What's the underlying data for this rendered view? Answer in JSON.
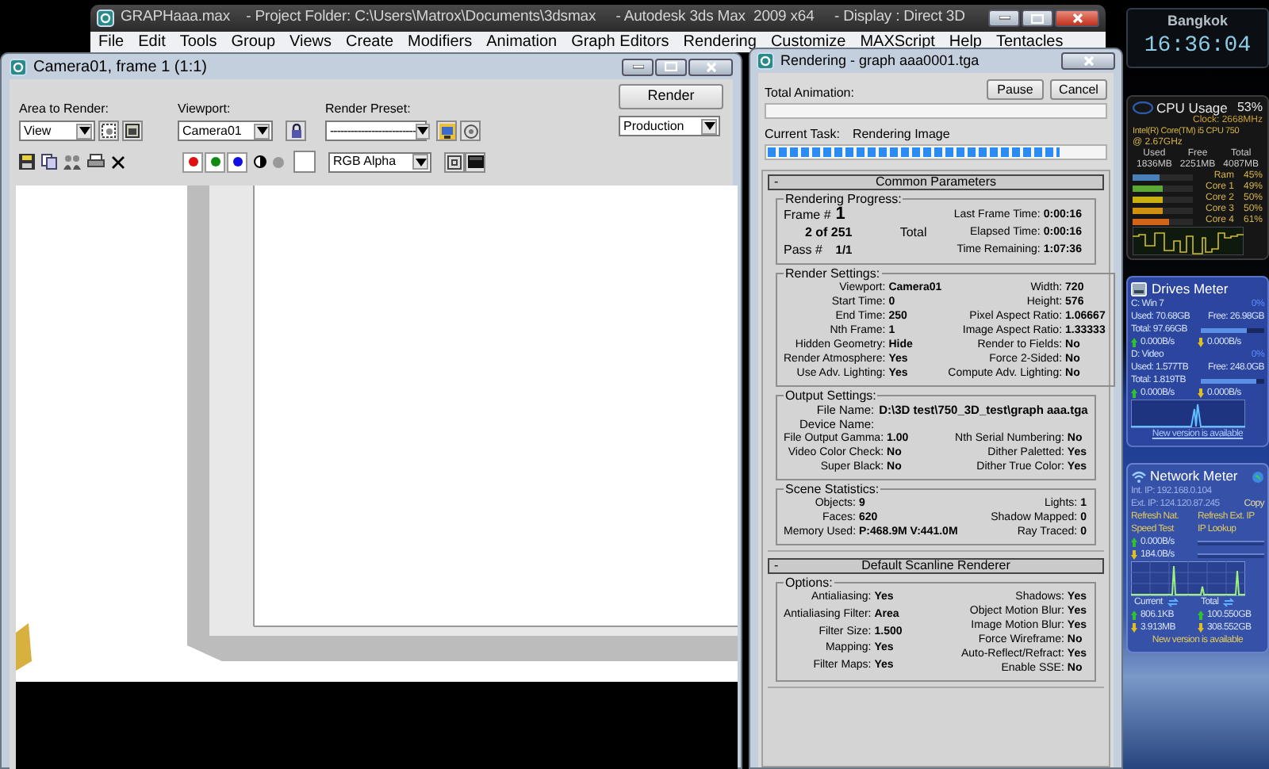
{
  "max_window": {
    "title": "GRAPHaaa.max    - Project Folder: C:\\Users\\Matrox\\Documents\\3dsmax     - Autodesk 3ds Max  2009 x64     - Display : Direct 3D",
    "menu": [
      "File",
      "Edit",
      "Tools",
      "Group",
      "Views",
      "Create",
      "Modifiers",
      "Animation",
      "Graph Editors",
      "Rendering",
      "Customize",
      "MAXScript",
      "Help",
      "Tentacles"
    ]
  },
  "frame_window": {
    "title": "Camera01, frame 1 (1:1)",
    "area_label": "Area to Render:",
    "area_value": "View",
    "viewport_label": "Viewport:",
    "viewport_value": "Camera01",
    "preset_label": "Render Preset:",
    "preset_value": "-------------------------",
    "render_button": "Render",
    "mode_value": "Production",
    "channels": [
      {
        "color": "#e01010"
      },
      {
        "color": "#108a10"
      },
      {
        "color": "#1010e0"
      }
    ],
    "display_value": "RGB Alpha"
  },
  "render_dialog": {
    "title": "Rendering - graph aaa0001.tga",
    "buttons": [
      "Pause",
      "Cancel"
    ],
    "total_animation": {
      "label": "Total Animation:",
      "level": 0
    },
    "current_task": {
      "label": "Current Task:",
      "value": "Rendering Image",
      "level": 0.87
    },
    "rollouts": [
      {
        "expander": "-",
        "title": "Common Parameters",
        "groups": [
          {
            "kind": "progress",
            "title": "Rendering Progress:",
            "frame_label": "Frame #",
            "frame_value": "1",
            "count": "2 of 251",
            "total": "Total",
            "pass_label": "Pass #",
            "pass_value": "1/1",
            "right": [
              {
                "label": "Last Frame Time:",
                "value": "0:00:16"
              },
              {
                "label": "Elapsed Time:",
                "value": "0:00:16"
              },
              {
                "label": "Time Remaining:",
                "value": "1:07:36"
              }
            ]
          },
          {
            "kind": "fields",
            "title": "Render Settings:",
            "left": [
              {
                "label": "Viewport:",
                "value": "Camera01"
              },
              {
                "label": "Start Time:",
                "value": "0"
              },
              {
                "label": "End Time:",
                "value": "250"
              },
              {
                "label": "Nth Frame:",
                "value": "1"
              },
              {
                "label": "Hidden Geometry:",
                "value": "Hide"
              },
              {
                "label": "Render Atmosphere:",
                "value": "Yes"
              },
              {
                "label": "Use Adv. Lighting:",
                "value": "Yes"
              }
            ],
            "right": [
              {
                "label": "Width:",
                "value": "720"
              },
              {
                "label": "Height:",
                "value": "576"
              },
              {
                "label": "Pixel Aspect Ratio:",
                "value": "1.06667"
              },
              {
                "label": "Image Aspect Ratio:",
                "value": "1.33333"
              },
              {
                "label": "Render to Fields:",
                "value": "No"
              },
              {
                "label": "Force 2-Sided:",
                "value": "No"
              },
              {
                "label": "Compute Adv. Lighting:",
                "value": "No"
              }
            ]
          },
          {
            "kind": "fields",
            "title": "Output Settings:",
            "full": [
              {
                "label": "File Name:",
                "value": "D:\\3D test\\750_3D_test\\graph aaa.tga"
              },
              {
                "label": "Device Name:"
              }
            ],
            "left": [
              {
                "label": "File Output Gamma:",
                "value": "1.00"
              },
              {
                "label": "Video Color Check:",
                "value": "No"
              },
              {
                "label": "Super Black:",
                "value": "No"
              }
            ],
            "right": [
              {
                "label": "Nth Serial Numbering:",
                "value": "No"
              },
              {
                "label": "Dither Paletted:",
                "value": "Yes"
              },
              {
                "label": "Dither True Color:",
                "value": "Yes"
              }
            ]
          },
          {
            "kind": "fields",
            "title": "Scene Statistics:",
            "left": [
              {
                "label": "Objects:",
                "value": "9"
              },
              {
                "label": "Faces:",
                "value": "620"
              },
              {
                "label": "Memory Used:",
                "value": "P:468.9M V:441.0M"
              }
            ],
            "right": [
              {
                "label": "Lights:",
                "value": "1"
              },
              {
                "label": "Shadow Mapped:",
                "value": "0"
              },
              {
                "label": "Ray Traced:",
                "value": "0"
              }
            ]
          }
        ]
      },
      {
        "expander": "-",
        "title": "Default Scanline Renderer",
        "groups": [
          {
            "kind": "fields",
            "title": "Options:",
            "left": [
              {
                "label": "Antialiasing:",
                "value": "Yes"
              },
              {
                "label": "Antialiasing Filter:",
                "value": "Area"
              },
              {
                "label": "Filter Size:",
                "value": "1.500"
              },
              {
                "label": "Mapping:",
                "value": "Yes"
              },
              {
                "label": "Filter Maps:",
                "value": "Yes"
              }
            ],
            "right": [
              {
                "label": "Shadows:",
                "value": "Yes"
              },
              {
                "label": "Object Motion Blur:",
                "value": "Yes"
              },
              {
                "label": "Image Motion Blur:",
                "value": "Yes"
              },
              {
                "label": "Force Wireframe:",
                "value": "No"
              },
              {
                "label": "Auto-Reflect/Refract:",
                "value": "Yes"
              },
              {
                "label": "Enable SSE:",
                "value": "No"
              }
            ]
          }
        ]
      }
    ]
  },
  "clock": {
    "city": "Bangkok",
    "time": "16:36:04"
  },
  "cpu_meter": {
    "title": "CPU Usage",
    "percent": "53%",
    "clock": "Clock: 2668MHz",
    "processor": "Intel(R) Core(TM) i5 CPU 750",
    "speed": "@ 2.67GHz",
    "memory_headers": [
      "Used",
      "Free",
      "Total"
    ],
    "memory_values": [
      "1836MB",
      "2251MB",
      "4087MB"
    ],
    "bars": [
      {
        "label": "Ram",
        "reading": "45%",
        "level": 0.45,
        "color": "#4a80b8"
      },
      {
        "label": "Core 1",
        "reading": "49%",
        "level": 0.49,
        "color": "#5aa832"
      },
      {
        "label": "Core 2",
        "reading": "50%",
        "level": 0.5,
        "color": "#c8b010"
      },
      {
        "label": "Core 3",
        "reading": "50%",
        "level": 0.5,
        "color": "#d09010"
      },
      {
        "label": "Core 4",
        "reading": "61%",
        "level": 0.61,
        "color": "#d06418"
      }
    ]
  },
  "drives_meter": {
    "title": "Drives Meter",
    "drives": [
      {
        "name": "C: Win 7",
        "percent": "0%",
        "used": "Used: 70.68GB",
        "free": "Free: 26.98GB",
        "total": "Total: 97.66GB",
        "level": 0.72,
        "read": "0.000B/s",
        "write": "0.000B/s"
      },
      {
        "name": "D: Video",
        "percent": "0%",
        "used": "Used: 1.577TB",
        "free": "Free: 248.0GB",
        "total": "Total: 1.819TB",
        "level": 0.87,
        "read": "0.000B/s",
        "write": "0.000B/s"
      }
    ],
    "link": "New version is available"
  },
  "network_meter": {
    "title": "Network Meter",
    "int_ip": "Int. IP: 192.168.0.104",
    "ext_ip": "Ext. IP: 124.120.87.245",
    "copy": "Copy",
    "links": [
      "Refresh Nat.",
      "Refresh Ext. IP",
      "Speed Test",
      "IP Lookup"
    ],
    "upload": "0.000B/s",
    "download": "184.0B/s",
    "current_label": "Current",
    "total_label": "Total",
    "current_up": "806.1KB",
    "current_down": "3.913MB",
    "total_up": "100.550GB",
    "total_down": "308.552GB",
    "link": "New version is available"
  }
}
